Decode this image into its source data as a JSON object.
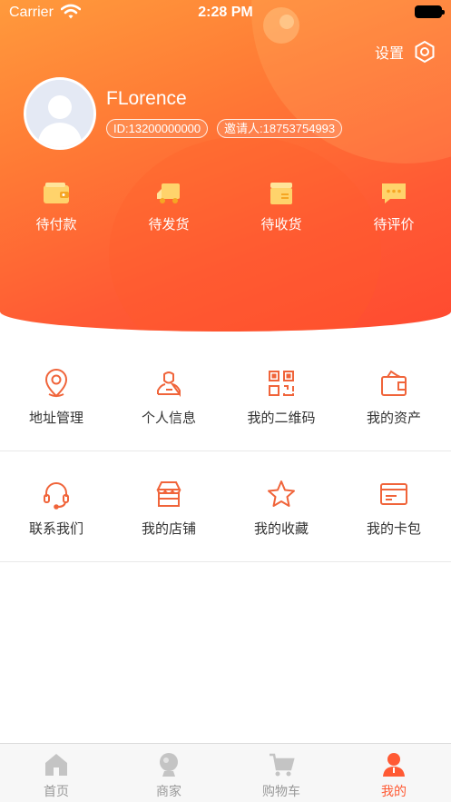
{
  "status_bar": {
    "carrier": "Carrier",
    "time": "2:28 PM"
  },
  "header": {
    "settings_label": "设置",
    "username": "FLorence",
    "id_text": "ID:13200000000",
    "inviter_text": "邀请人:18753754993"
  },
  "orders": [
    {
      "label": "待付款",
      "icon": "wallet-icon"
    },
    {
      "label": "待发货",
      "icon": "truck-icon"
    },
    {
      "label": "待收货",
      "icon": "package-icon"
    },
    {
      "label": "待评价",
      "icon": "comment-icon"
    }
  ],
  "menu": [
    {
      "label": "地址管理",
      "icon": "location-icon"
    },
    {
      "label": "个人信息",
      "icon": "person-icon"
    },
    {
      "label": "我的二维码",
      "icon": "qrcode-icon"
    },
    {
      "label": "我的资产",
      "icon": "assets-icon"
    },
    {
      "label": "联系我们",
      "icon": "headset-icon"
    },
    {
      "label": "我的店铺",
      "icon": "store-icon"
    },
    {
      "label": "我的收藏",
      "icon": "star-icon"
    },
    {
      "label": "我的卡包",
      "icon": "card-icon"
    }
  ],
  "tabbar": [
    {
      "label": "首页",
      "icon": "home-icon"
    },
    {
      "label": "商家",
      "icon": "merchant-icon"
    },
    {
      "label": "购物车",
      "icon": "cart-icon"
    },
    {
      "label": "我的",
      "icon": "profile-icon",
      "active": true
    }
  ],
  "colors": {
    "accent": "#ff5a34",
    "accent_light": "#ff9a3c",
    "icon_stroke": "#f0643a",
    "order_icon": "#ffd36b"
  }
}
